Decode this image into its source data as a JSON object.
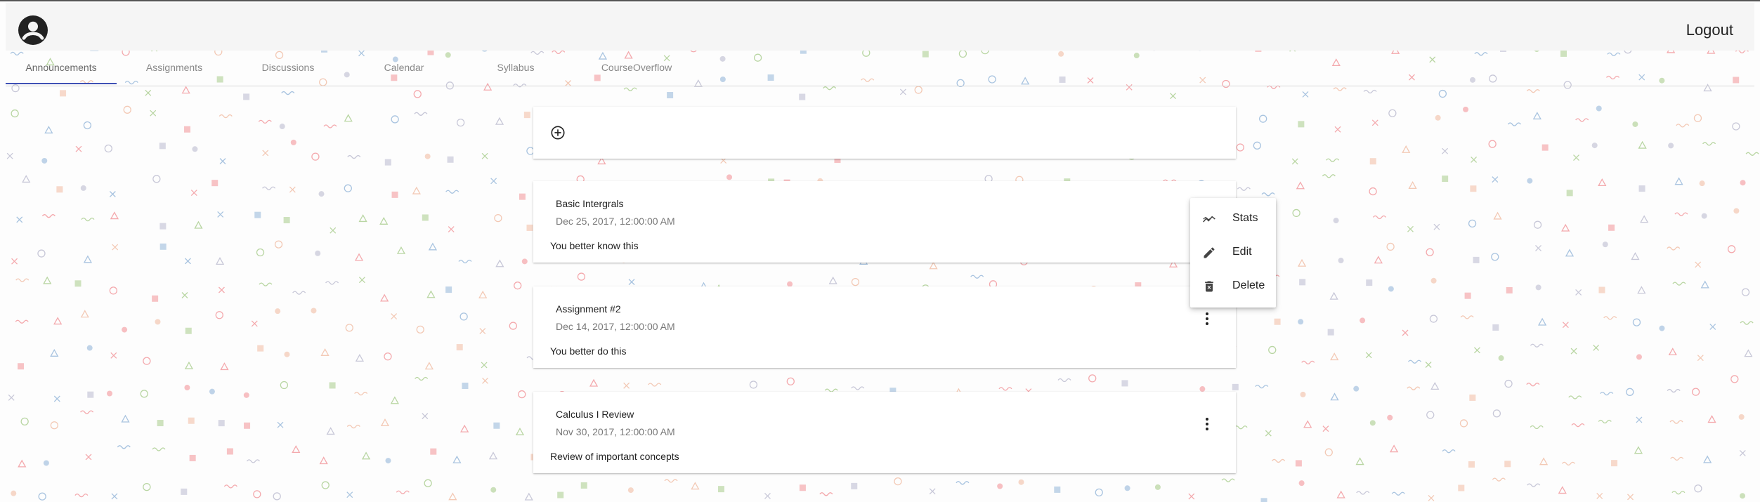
{
  "header": {
    "avatar_icon": "account-circle-icon",
    "logout_label": "Logout"
  },
  "tabs": [
    {
      "label": "Announcements",
      "active": true
    },
    {
      "label": "Assignments",
      "active": false
    },
    {
      "label": "Discussions",
      "active": false
    },
    {
      "label": "Calendar",
      "active": false
    },
    {
      "label": "Syllabus",
      "active": false
    },
    {
      "label": "CourseOverflow",
      "active": false
    }
  ],
  "add_card": {
    "icon": "add-circle-icon"
  },
  "announcements": [
    {
      "title": "Basic Intergrals",
      "date": "Dec 25, 2017, 12:00:00 AM",
      "body": "You better know this"
    },
    {
      "title": "Assignment #2",
      "date": "Dec 14, 2017, 12:00:00 AM",
      "body": "You better do this"
    },
    {
      "title": "Calculus I Review",
      "date": "Nov 30, 2017, 12:00:00 AM",
      "body": "Review of important concepts"
    }
  ],
  "context_menu": {
    "items": [
      {
        "label": "Stats",
        "icon": "stats-icon"
      },
      {
        "label": "Edit",
        "icon": "pencil-icon"
      },
      {
        "label": "Delete",
        "icon": "trash-icon"
      }
    ]
  },
  "colors": {
    "accent": "#3f51b5",
    "topbar": "#f5f5f5",
    "pattern": [
      "#f4a9ad",
      "#a9c4e0",
      "#b9d6a3",
      "#c8c8d8",
      "#f3c9b5"
    ]
  }
}
